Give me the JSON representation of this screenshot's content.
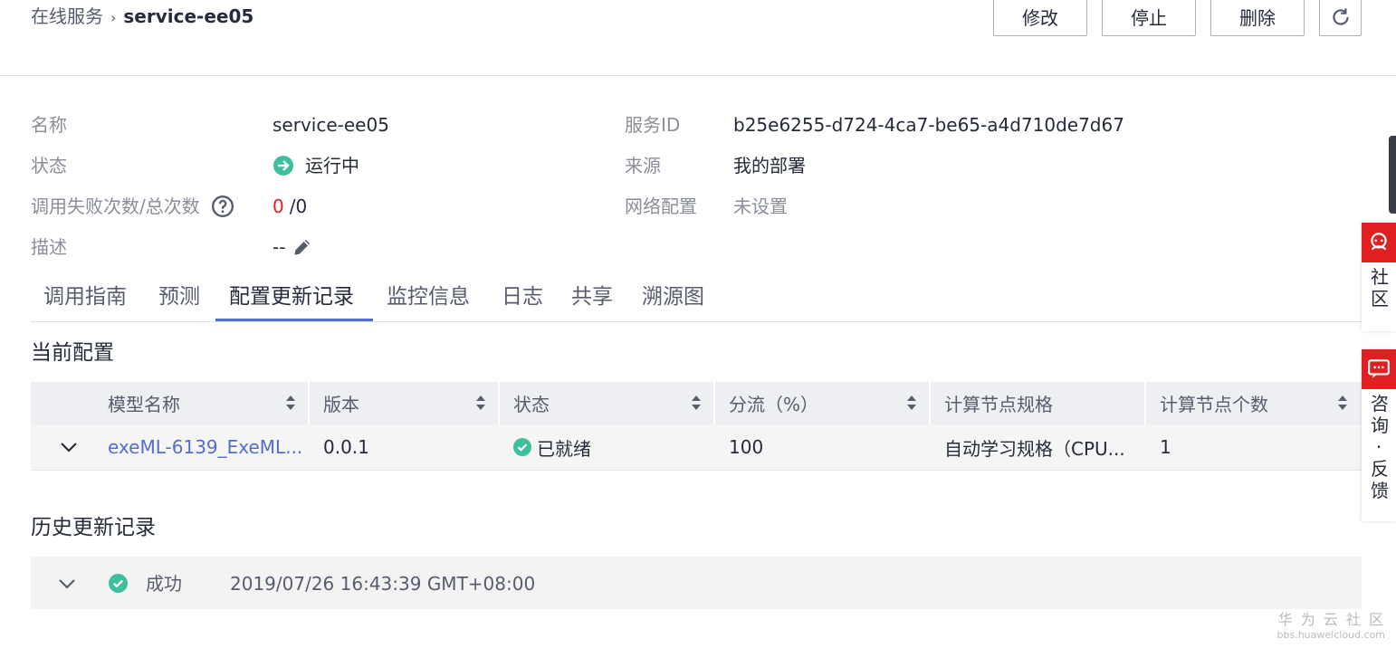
{
  "breadcrumb": {
    "parent": "在线服务",
    "separator": "›",
    "current": "service-ee05"
  },
  "header_buttons": {
    "modify": "修改",
    "stop": "停止",
    "delete": "删除",
    "refresh_icon": "refresh-icon"
  },
  "info": {
    "name_label": "名称",
    "name_value": "service-ee05",
    "status_label": "状态",
    "status_value": "运行中",
    "calls_label": "调用失败次数/总次数",
    "calls_failed": "0",
    "calls_total": "/0",
    "desc_label": "描述",
    "desc_value": "--",
    "service_id_label": "服务ID",
    "service_id_value": "b25e6255-d724-4ca7-be65-a4d710de7d67",
    "source_label": "来源",
    "source_value": "我的部署",
    "network_label": "网络配置",
    "network_value": "未设置"
  },
  "tabs": [
    "调用指南",
    "预测",
    "配置更新记录",
    "监控信息",
    "日志",
    "共享",
    "溯源图"
  ],
  "active_tab": "配置更新记录",
  "current_config": {
    "title": "当前配置",
    "columns": [
      "模型名称",
      "版本",
      "状态",
      "分流（%）",
      "计算节点规格",
      "计算节点个数"
    ],
    "rows": [
      {
        "model": "exeML-6139_ExeML...",
        "version": "0.0.1",
        "status": "已就绪",
        "traffic": "100",
        "spec": "自动学习规格（CPU...",
        "count": "1"
      }
    ]
  },
  "history": {
    "title": "历史更新记录",
    "items": [
      {
        "status": "成功",
        "time": "2019/07/26 16:43:39 GMT+08:00"
      }
    ]
  },
  "float_panel": {
    "community": "社区",
    "consult": "咨询·反馈"
  },
  "watermark": {
    "line1": "华 为 云 社 区",
    "line2": "bbs.huaweicloud.com"
  },
  "colors": {
    "accent": "#526ecc",
    "success": "#50c878",
    "danger": "#e02020"
  }
}
